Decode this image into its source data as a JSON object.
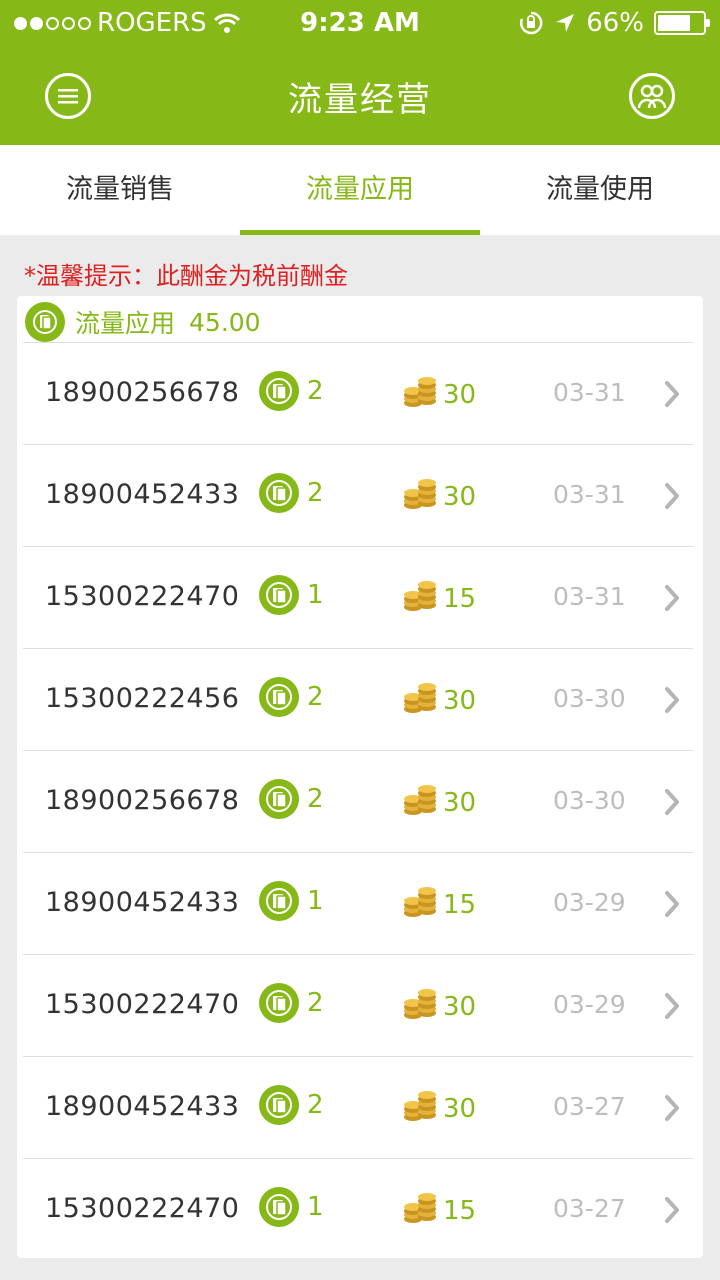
{
  "status_bar": {
    "carrier": "ROGERS",
    "time": "9:23 AM",
    "battery": "66%"
  },
  "header": {
    "title": "流量经营",
    "menu_icon": "menu-icon",
    "users_icon": "users-icon"
  },
  "tabs": [
    {
      "label": "流量销售"
    },
    {
      "label": "流量应用"
    },
    {
      "label": "流量使用"
    }
  ],
  "tip": "*温馨提示：此酬金为税前酬金",
  "summary": {
    "label": "流量应用",
    "amount": "45.00"
  },
  "rows": [
    {
      "phone": "18900256678",
      "apps": "2",
      "coins": "30",
      "date": "03-31"
    },
    {
      "phone": "18900452433",
      "apps": "2",
      "coins": "30",
      "date": "03-31"
    },
    {
      "phone": "15300222470",
      "apps": "1",
      "coins": "15",
      "date": "03-31"
    },
    {
      "phone": "15300222456",
      "apps": "2",
      "coins": "30",
      "date": "03-30"
    },
    {
      "phone": "18900256678",
      "apps": "2",
      "coins": "30",
      "date": "03-30"
    },
    {
      "phone": "18900452433",
      "apps": "1",
      "coins": "15",
      "date": "03-29"
    },
    {
      "phone": "15300222470",
      "apps": "2",
      "coins": "30",
      "date": "03-29"
    },
    {
      "phone": "18900452433",
      "apps": "2",
      "coins": "30",
      "date": "03-27"
    },
    {
      "phone": "15300222470",
      "apps": "1",
      "coins": "15",
      "date": "03-27"
    }
  ],
  "colors": {
    "brand": "#86b817",
    "tip": "#e02020",
    "coin": "#d9a62a"
  }
}
